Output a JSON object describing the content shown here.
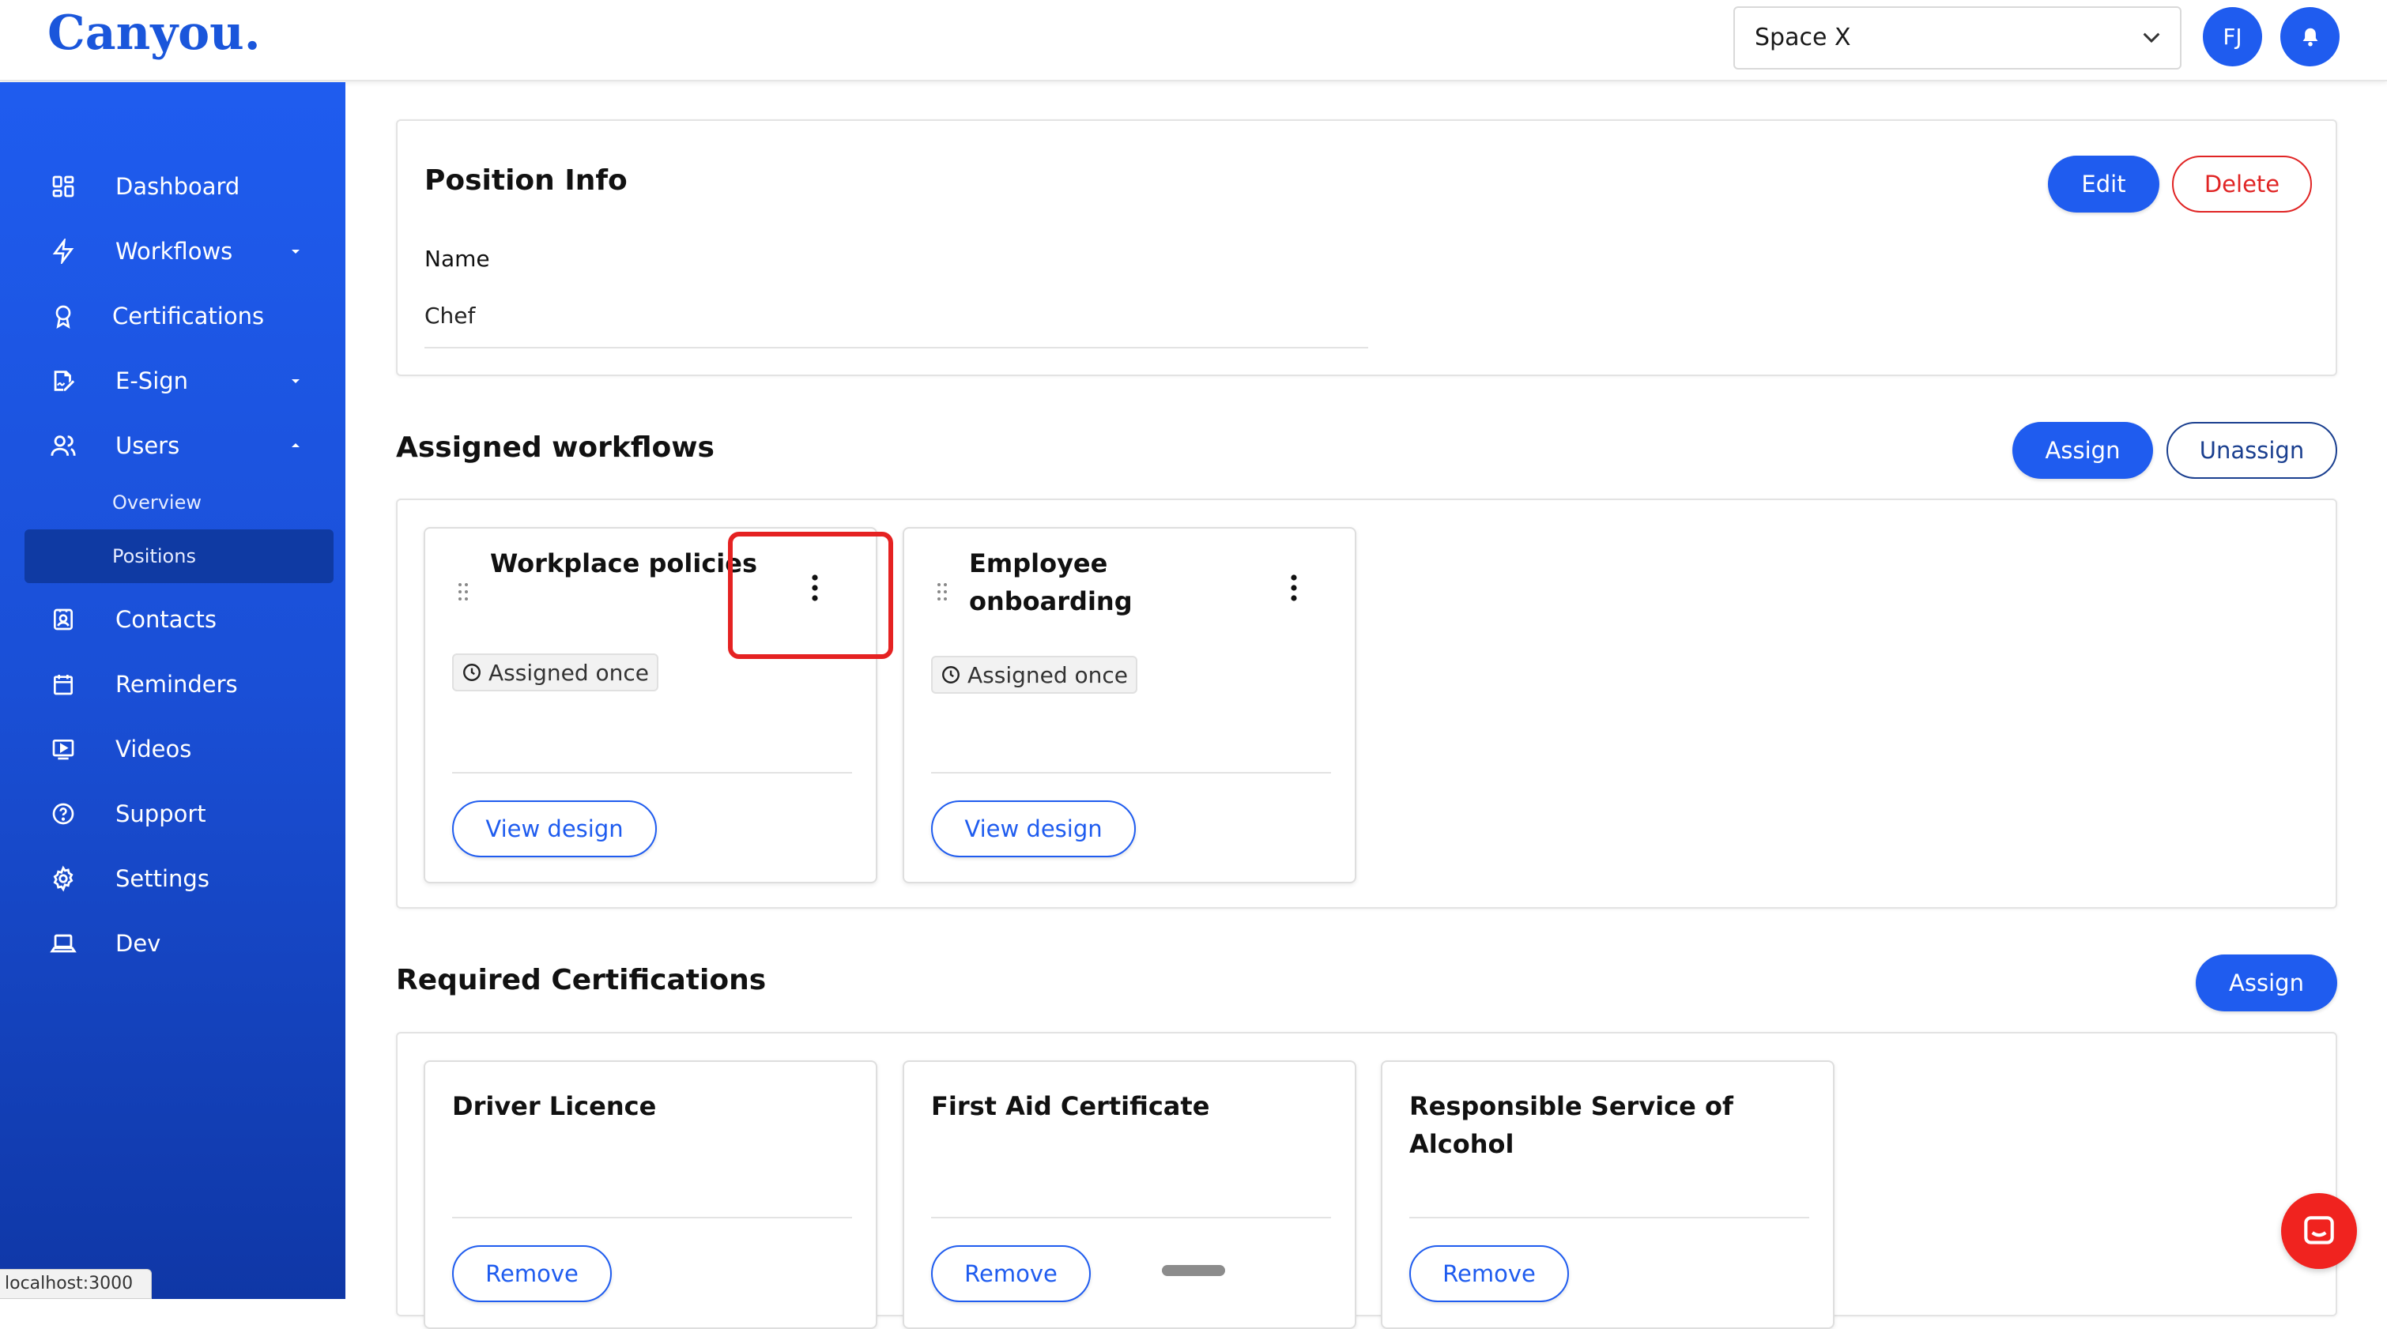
{
  "app": {
    "logo": "Canyou."
  },
  "topbar": {
    "space_select_value": "Space X",
    "avatar_initials": "FJ"
  },
  "sidebar": {
    "items": [
      {
        "label": "Dashboard",
        "icon": "dashboard-grid-icon"
      },
      {
        "label": "Workflows",
        "icon": "lightning-icon"
      },
      {
        "label": "Certifications",
        "icon": "award-ribbon-icon"
      },
      {
        "label": "E-Sign",
        "icon": "signature-icon"
      },
      {
        "label": "Users",
        "icon": "users-icon"
      },
      {
        "label": "Contacts",
        "icon": "contact-card-icon"
      },
      {
        "label": "Reminders",
        "icon": "calendar-icon"
      },
      {
        "label": "Videos",
        "icon": "video-play-icon"
      },
      {
        "label": "Support",
        "icon": "help-circle-icon"
      },
      {
        "label": "Settings",
        "icon": "gear-icon"
      },
      {
        "label": "Dev",
        "icon": "laptop-icon"
      }
    ],
    "users_sub": [
      {
        "label": "Overview"
      },
      {
        "label": "Positions"
      }
    ]
  },
  "position_info": {
    "title": "Position Info",
    "edit_label": "Edit",
    "delete_label": "Delete",
    "name_label": "Name",
    "name_value": "Chef"
  },
  "assigned_workflows": {
    "title": "Assigned workflows",
    "assign_label": "Assign",
    "unassign_label": "Unassign",
    "cards": [
      {
        "title": "Workplace policies",
        "badge": "Assigned once",
        "button": "View design"
      },
      {
        "title_line1": "Employee",
        "title_line2": "onboarding",
        "badge": "Assigned once",
        "button": "View design"
      }
    ]
  },
  "required_certifications": {
    "title": "Required Certifications",
    "assign_label": "Assign",
    "cards": [
      {
        "title": "Driver Licence",
        "button": "Remove"
      },
      {
        "title": "First Aid Certificate",
        "button": "Remove"
      },
      {
        "title_line1": "Responsible Service of",
        "title_line2": "Alcohol",
        "button": "Remove"
      }
    ]
  },
  "status_bar": {
    "url_text": "localhost:3000"
  },
  "colors": {
    "primary": "#1f5cef",
    "sidebar_dark": "#0f37a6",
    "danger": "#e02424",
    "highlight": "#e52222",
    "chat": "#f0231f"
  }
}
